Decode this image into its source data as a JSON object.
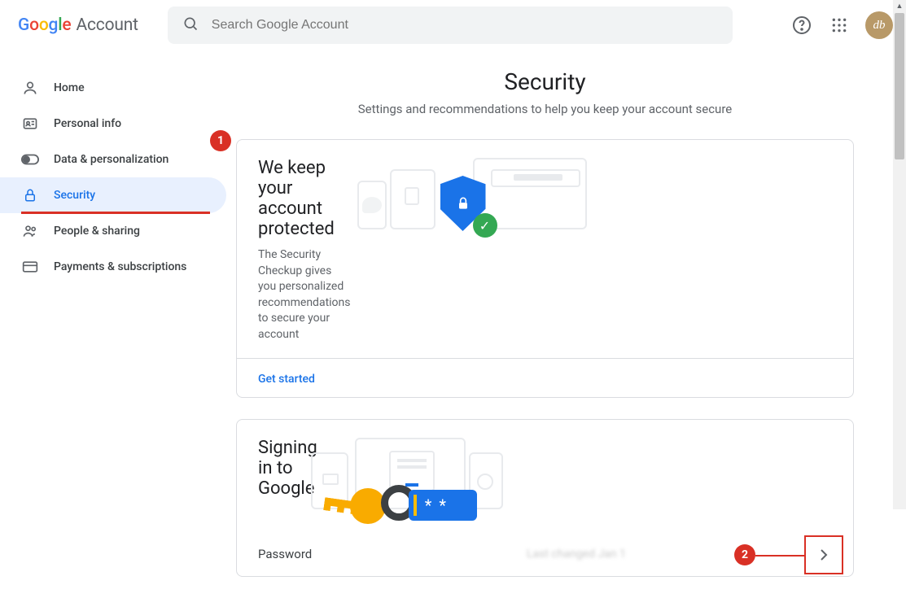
{
  "header": {
    "logo_account": "Account",
    "search_placeholder": "Search Google Account",
    "avatar_initials": "db"
  },
  "sidebar": {
    "items": [
      {
        "label": "Home"
      },
      {
        "label": "Personal info"
      },
      {
        "label": "Data & personalization"
      },
      {
        "label": "Security"
      },
      {
        "label": "People & sharing"
      },
      {
        "label": "Payments & subscriptions"
      }
    ]
  },
  "annotations": {
    "badge1": "1",
    "badge2": "2"
  },
  "page": {
    "title": "Security",
    "subtitle": "Settings and recommendations to help you keep your account secure"
  },
  "card_protect": {
    "title": "We keep your account protected",
    "desc": "The Security Checkup gives you personalized recommendations to secure your account",
    "cta": "Get started"
  },
  "card_signin": {
    "title": "Signing in to Google",
    "row_label": "Password",
    "row_value": "Last changed Jan 1",
    "pw_mask": "* *"
  }
}
